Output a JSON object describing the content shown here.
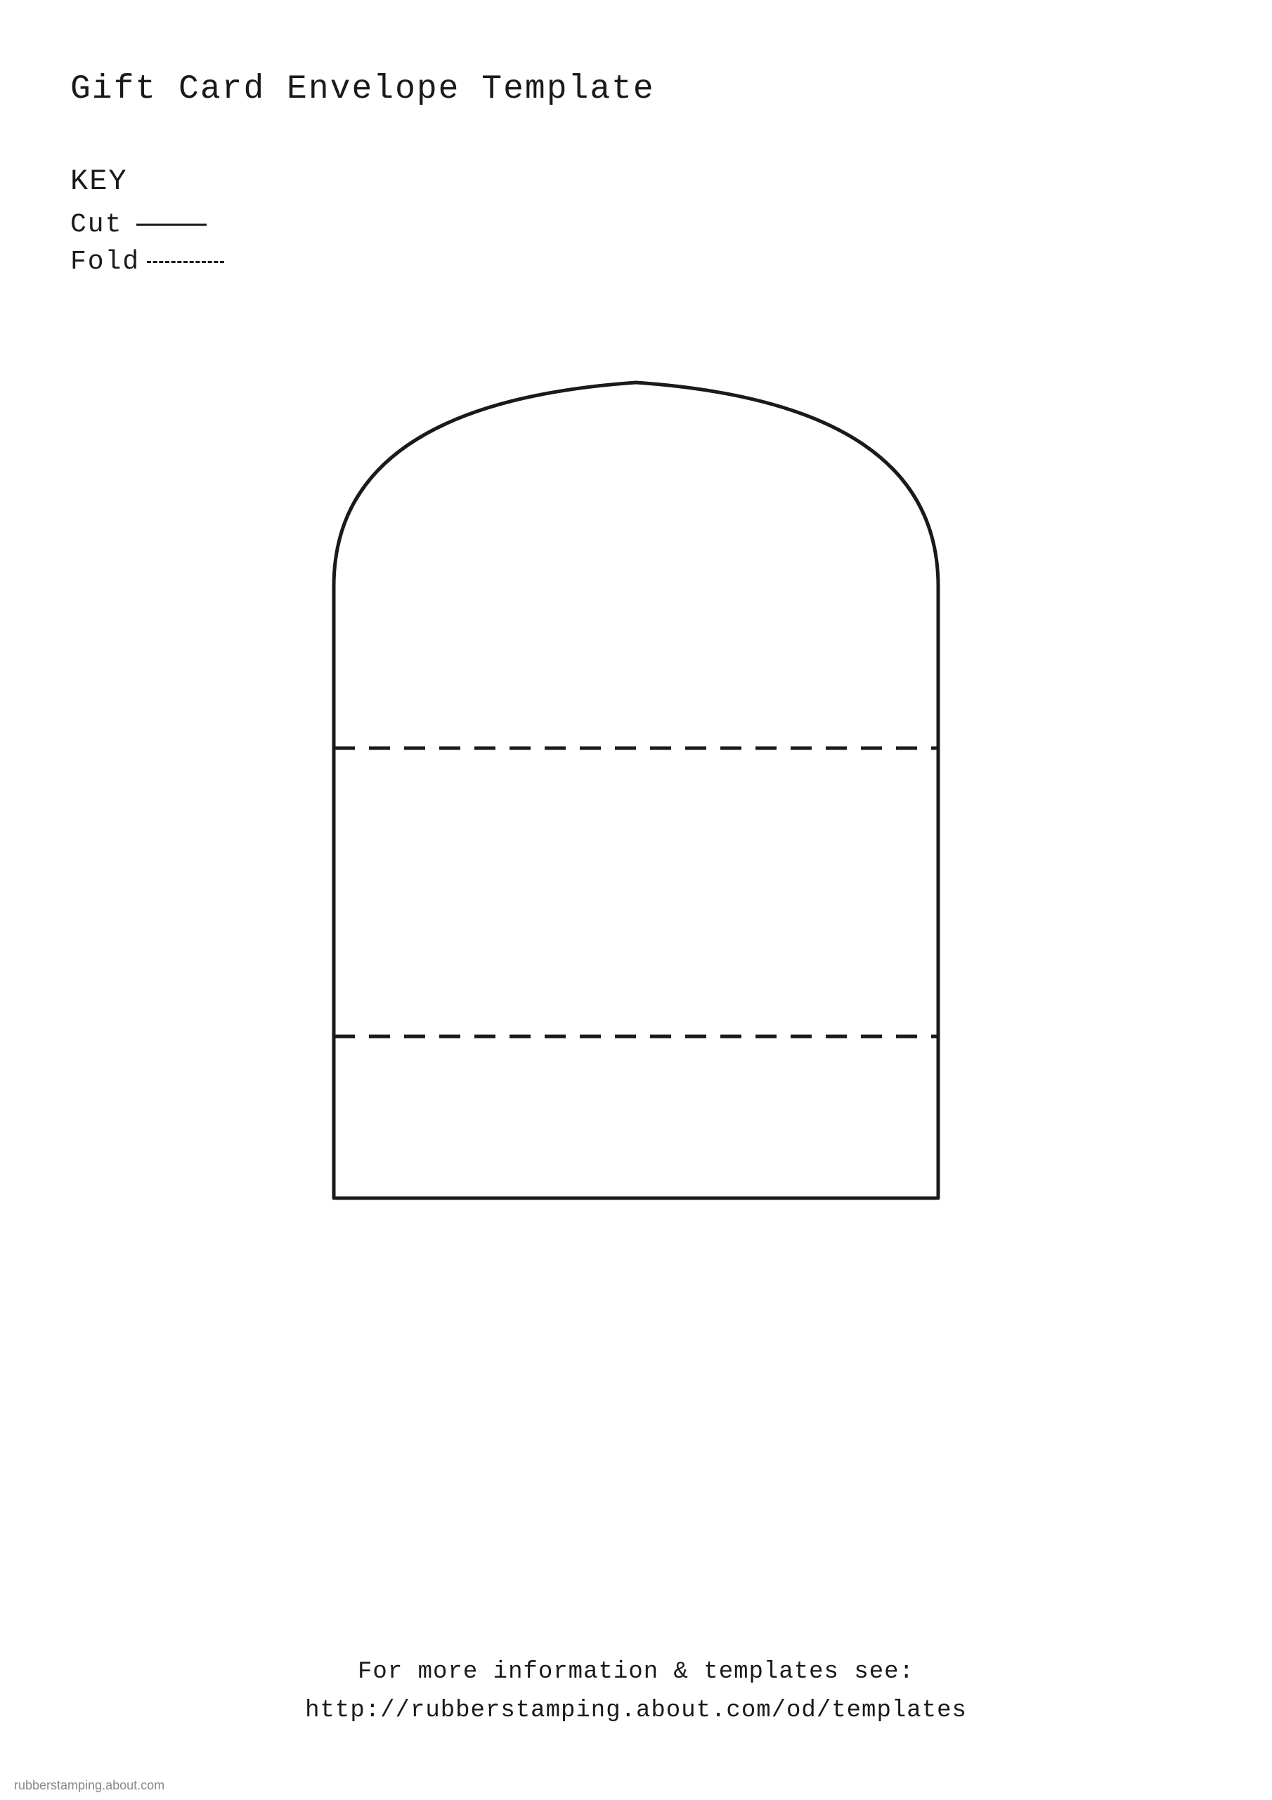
{
  "page": {
    "background": "#ffffff"
  },
  "title": "Gift Card Envelope Template",
  "key": {
    "heading": "KEY",
    "items": [
      {
        "label": "Cut",
        "line_type": "solid"
      },
      {
        "label": "Fold",
        "line_type": "dashed"
      }
    ]
  },
  "footer": {
    "line1": "For more information & templates see:",
    "line2": "http://rubberstamping.about.com/od/templates"
  },
  "watermark": "rubberstamping.about.com"
}
